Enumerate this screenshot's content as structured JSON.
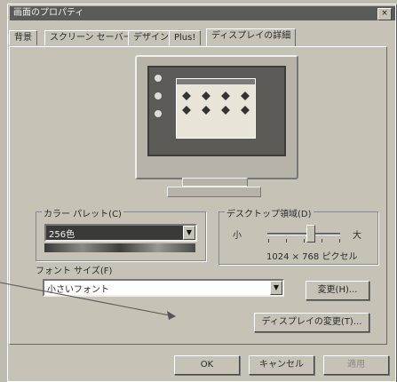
{
  "window": {
    "title": "画面のプロパティ",
    "close_glyph": "×"
  },
  "tabs": [
    {
      "label": "背景"
    },
    {
      "label": "スクリーン セーバー"
    },
    {
      "label": "デザイン"
    },
    {
      "label": "Plus!"
    },
    {
      "label": "ディスプレイの詳細"
    }
  ],
  "color_palette": {
    "label": "カラー パレット(C)",
    "value": "256色"
  },
  "desktop_area": {
    "label": "デスクトップ領域(D)",
    "min_label": "小",
    "max_label": "大",
    "resolution_text": "1024 × 768 ピクセル",
    "slider_level_fraction": 0.6
  },
  "font_size": {
    "label": "フォント サイズ(F)",
    "value": "小さいフォント"
  },
  "buttons": {
    "change": "変更(H)...",
    "change_display": "ディスプレイの変更(T)...",
    "ok": "OK",
    "cancel": "キャンセル",
    "apply": "適用"
  },
  "icons": {
    "dropdown": "▼"
  },
  "colors": {
    "title_bar": "#5a5a58",
    "palette_selection": "#3a3a38"
  }
}
